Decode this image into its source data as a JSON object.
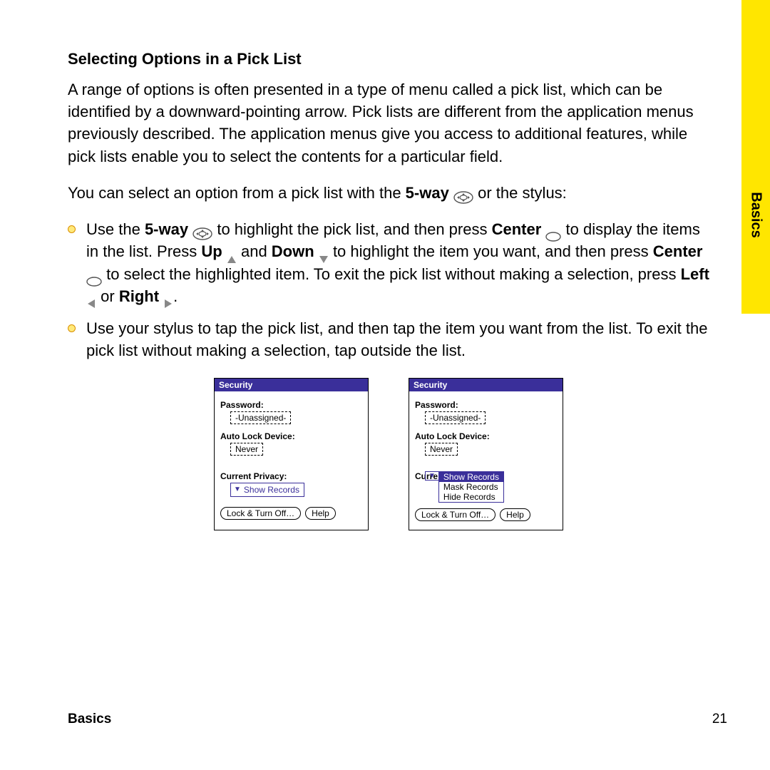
{
  "sideTab": "Basics",
  "heading": "Selecting Options in a Pick List",
  "para1": "A range of options is often presented in a type of menu called a pick list, which can be identified by a downward-pointing arrow. Pick lists are different from the application menus previously described. The application menus give you access to additional features, while pick lists enable you to select the contents for a particular field.",
  "para2_pre": "You can select an option from a pick list with the ",
  "para2_bold": "5-way",
  "para2_post": " or the stylus:",
  "bullets": {
    "b1": {
      "t0": "Use the ",
      "bold0": "5-way",
      "t1": " to highlight the pick list, and then press ",
      "bold1": "Center",
      "t2": " to display the items in the list. Press ",
      "bold2": "Up",
      "t3": " and ",
      "bold3": "Down",
      "t4": " to highlight the item you want, and then press ",
      "bold4": "Center",
      "t5": " to select the highlighted item. To exit the pick list without making a selection, press ",
      "bold5": "Left",
      "t6": " or ",
      "bold6": "Right",
      "t7": "."
    },
    "b2": "Use your stylus to tap the pick list, and then tap the item you want from the list. To exit the pick list without making a selection, tap outside the list."
  },
  "palm": {
    "title": "Security",
    "passwordLabel": "Password:",
    "passwordValue": "-Unassigned-",
    "autoLockLabel": "Auto Lock Device:",
    "autoLockValue": "Never",
    "privacyLabel": "Current Privacy:",
    "privacyLabelCut": "Curre",
    "picklistValue": "Show Records",
    "options": [
      "Show Records",
      "Mask Records",
      "Hide Records"
    ],
    "btnLock": "Lock & Turn Off…",
    "btnHelp": "Help"
  },
  "footer": {
    "section": "Basics",
    "page": "21"
  }
}
